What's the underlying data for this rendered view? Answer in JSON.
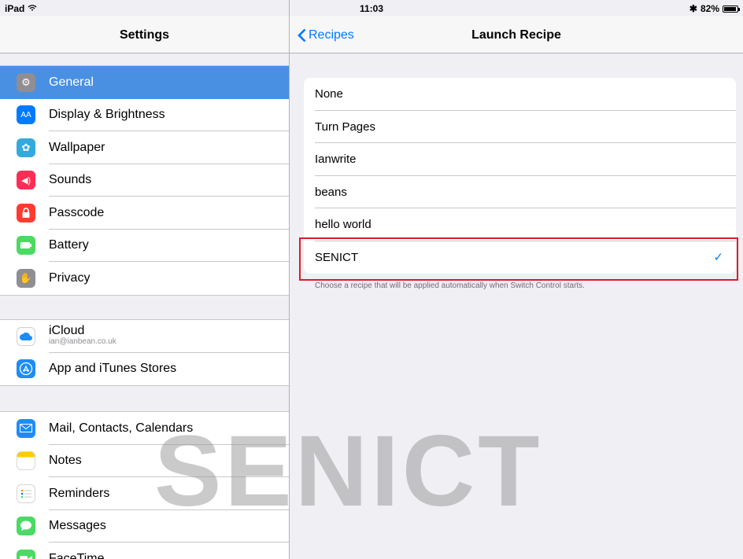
{
  "status": {
    "device": "iPad",
    "time": "11:03",
    "battery": "82%"
  },
  "sidebar": {
    "title": "Settings",
    "groups": [
      {
        "items": [
          {
            "label": "General",
            "icon": "gear-icon",
            "color": "#8e8e93",
            "selected": true
          },
          {
            "label": "Display & Brightness",
            "icon": "display-icon",
            "color": "#007aff"
          },
          {
            "label": "Wallpaper",
            "icon": "flower-icon",
            "color": "#34aadc"
          },
          {
            "label": "Sounds",
            "icon": "speaker-icon",
            "color": "#ff2d55"
          },
          {
            "label": "Passcode",
            "icon": "lock-icon",
            "color": "#ff3b30"
          },
          {
            "label": "Battery",
            "icon": "battery-icon",
            "color": "#4cd964"
          },
          {
            "label": "Privacy",
            "icon": "hand-icon",
            "color": "#8e8e93"
          }
        ]
      },
      {
        "items": [
          {
            "label": "iCloud",
            "sublabel": "ian@ianbean.co.uk",
            "icon": "cloud-icon",
            "color": "#ffffff"
          },
          {
            "label": "App and iTunes Stores",
            "icon": "app-store-icon",
            "color": "#1d8cf8"
          }
        ]
      },
      {
        "items": [
          {
            "label": "Mail, Contacts, Calendars",
            "icon": "mail-icon",
            "color": "#1d8cf8"
          },
          {
            "label": "Notes",
            "icon": "notes-icon",
            "color": "#ffcc00"
          },
          {
            "label": "Reminders",
            "icon": "reminders-icon",
            "color": "#ffffff"
          },
          {
            "label": "Messages",
            "icon": "messages-icon",
            "color": "#4cd964"
          },
          {
            "label": "FaceTime",
            "icon": "facetime-icon",
            "color": "#4cd964"
          }
        ]
      }
    ]
  },
  "detail": {
    "back_label": "Recipes",
    "title": "Launch Recipe",
    "options": [
      {
        "label": "None",
        "checked": false
      },
      {
        "label": "Turn Pages",
        "checked": false
      },
      {
        "label": "Ianwrite",
        "checked": false
      },
      {
        "label": "beans",
        "checked": false
      },
      {
        "label": "hello world",
        "checked": false
      },
      {
        "label": "SENICT",
        "checked": true
      }
    ],
    "footer": "Choose a recipe that will be applied automatically when Switch Control starts.",
    "check_glyph": "✓"
  },
  "watermark": "SENICT"
}
